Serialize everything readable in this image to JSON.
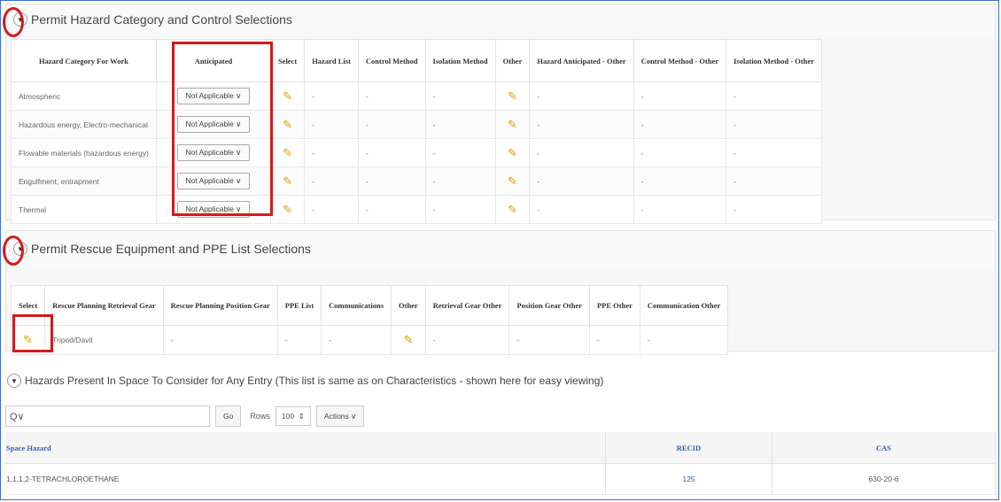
{
  "hazard_region": {
    "title": "Permit Hazard Category and Control Selections",
    "columns": [
      "Hazard Category For Work",
      "Anticipated",
      "Select",
      "Hazard List",
      "Control Method",
      "Isolation Method",
      "Other",
      "Hazard Anticipated - Other",
      "Control Method - Other",
      "Isolation Method - Other"
    ],
    "rows": [
      {
        "category": "Atmospheric",
        "anticipated": "Not Applicable",
        "hazard_list": "-",
        "control": "-",
        "isolation": "-",
        "ha_other": "-",
        "cm_other": "-",
        "im_other": "-"
      },
      {
        "category": "Hazardous energy, Electro-mechanical",
        "anticipated": "Not Applicable",
        "hazard_list": "-",
        "control": "-",
        "isolation": "-",
        "ha_other": "-",
        "cm_other": "-",
        "im_other": "-"
      },
      {
        "category": "Flowable materials (hazardous energy)",
        "anticipated": "Not Applicable",
        "hazard_list": "-",
        "control": "-",
        "isolation": "-",
        "ha_other": "-",
        "cm_other": "-",
        "im_other": "-"
      },
      {
        "category": "Engulfment, entrapment",
        "anticipated": "Not Applicable",
        "hazard_list": "-",
        "control": "-",
        "isolation": "-",
        "ha_other": "-",
        "cm_other": "-",
        "im_other": "-"
      },
      {
        "category": "Thermal",
        "anticipated": "Not Applicable",
        "hazard_list": "-",
        "control": "-",
        "isolation": "-",
        "ha_other": "-",
        "cm_other": "-",
        "im_other": "-"
      }
    ]
  },
  "rescue_region": {
    "title": "Permit Rescue Equipment and PPE List Selections",
    "columns": [
      "Select",
      "Rescue Planning Retrieval Gear",
      "Rescue Planning Position Gear",
      "PPE List",
      "Communications",
      "Other",
      "Retrieval Gear Other",
      "Position Gear Other",
      "PPE Other",
      "Communication Other"
    ],
    "row": {
      "retrieval": "Tripod/Davit",
      "position": "-",
      "ppe": "-",
      "comms": "-",
      "retrieval_other": "-",
      "position_other": "-",
      "ppe_other": "-",
      "comm_other": "-"
    }
  },
  "present_region": {
    "title": "Hazards Present In Space To Consider for Any Entry (This list is same as on Characteristics - shown here for easy viewing)",
    "search_icon": "Q∨",
    "go_label": "Go",
    "rows_label": "Rows",
    "rows_value": "100",
    "actions_label": "Actions",
    "columns": [
      "Space Hazard",
      "RECID",
      "CAS"
    ],
    "rows": [
      {
        "hazard": "1,1,1,2-TETRACHLOROETHANE",
        "recid": "125",
        "cas": "630-20-6"
      }
    ]
  },
  "icons": {
    "pencil": "✎",
    "toggle": "▼",
    "chevron": "∨"
  }
}
